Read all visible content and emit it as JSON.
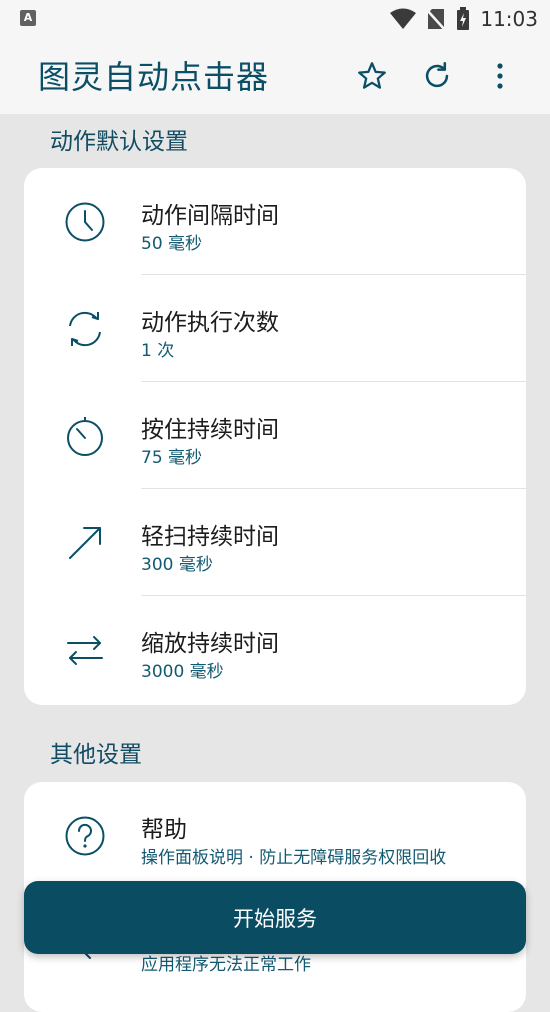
{
  "status_bar": {
    "time": "11:03"
  },
  "app_bar": {
    "title": "图灵自动点击器"
  },
  "sections": {
    "default": {
      "title": "动作默认设置"
    },
    "other": {
      "title": "其他设置"
    }
  },
  "default_items": [
    {
      "title": "动作间隔时间",
      "subtitle": "50 毫秒",
      "icon": "clock-icon"
    },
    {
      "title": "动作执行次数",
      "subtitle": "1 次",
      "icon": "repeat-icon"
    },
    {
      "title": "按住持续时间",
      "subtitle": "75 毫秒",
      "icon": "timer-icon"
    },
    {
      "title": "轻扫持续时间",
      "subtitle": "300 毫秒",
      "icon": "arrow-diagonal-icon"
    },
    {
      "title": "缩放持续时间",
      "subtitle": "3000 毫秒",
      "icon": "swap-arrows-icon"
    }
  ],
  "other_items": [
    {
      "title": "帮助",
      "subtitle": "操作面板说明 · 防止无障碍服务权限回收",
      "icon": "help-icon"
    },
    {
      "title": "",
      "subtitle": "应用程序无法正常工作",
      "icon": "tool-icon"
    }
  ],
  "start_button": {
    "label": "开始服务"
  },
  "colors": {
    "accent": "#0a4d63",
    "text_accent": "#125a72"
  }
}
